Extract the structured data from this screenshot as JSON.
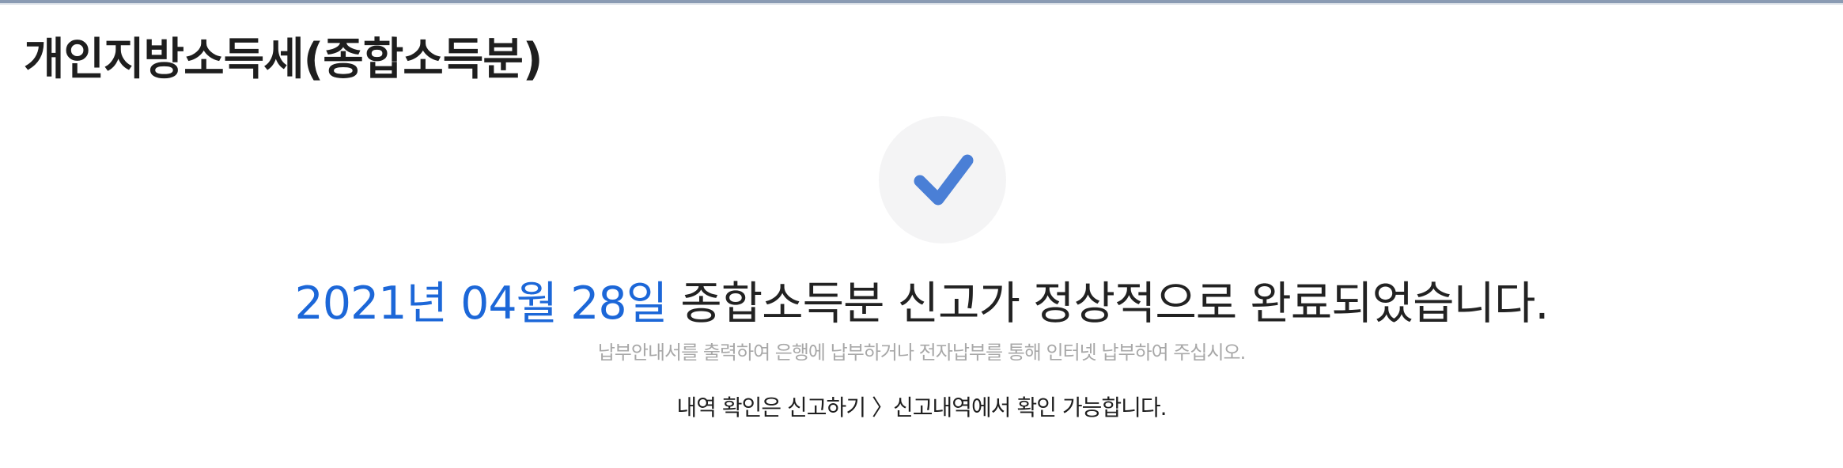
{
  "page": {
    "title": "개인지방소득세(종합소득분)"
  },
  "result": {
    "icon": "check-icon",
    "icon_color": "#4a7fd6",
    "circle_color": "#f4f4f5",
    "date_text": "2021년 04월 28일",
    "date_color": "#1c67d8",
    "message_text": " 종합소득분 신고가 정상적으로 완료되었습니다.",
    "guide_text": "납부안내서를 출력하여 은행에 납부하거나 전자납부를 통해 인터넷 납부하여 주십시오.",
    "info_text": "내역 확인은 신고하기 〉신고내역에서 확인 가능합니다."
  }
}
